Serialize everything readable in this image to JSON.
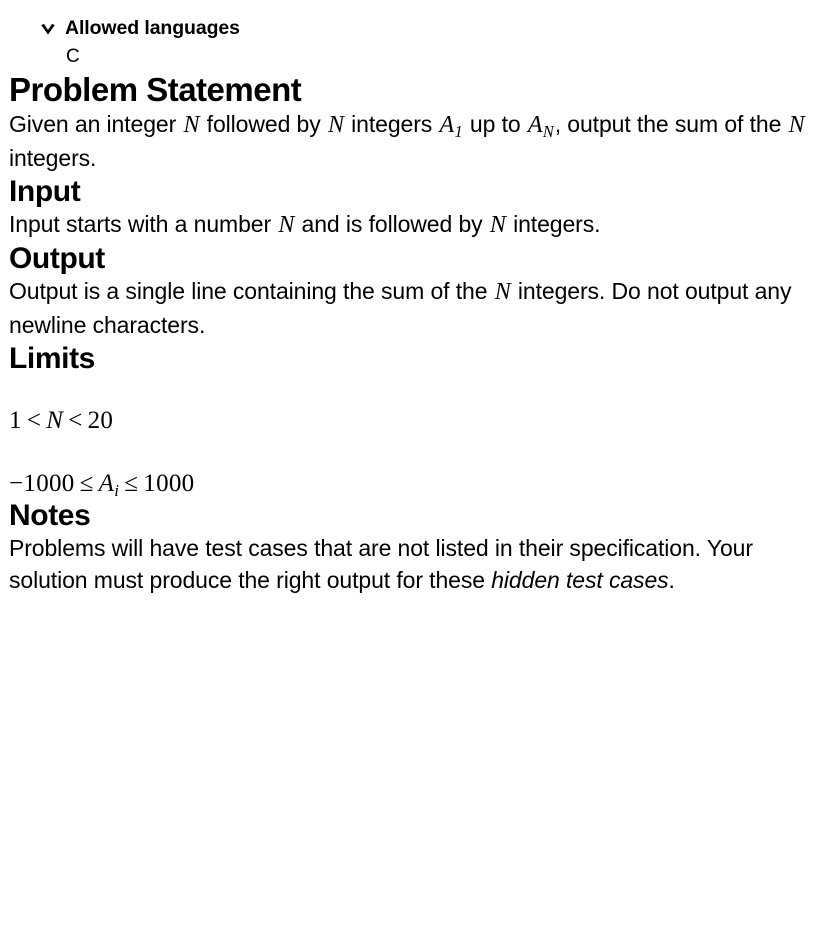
{
  "allowed_languages": {
    "title": "Allowed languages",
    "disclosure_icon": "chevron-down-icon",
    "expanded": true,
    "languages": [
      "C"
    ]
  },
  "sections": {
    "problem_statement": {
      "heading": "Problem Statement",
      "line1_a": "Given an integer ",
      "var_n_1": "N",
      "line1_b": " followed by ",
      "var_n_2": "N",
      "line1_c": " integers ",
      "var_a1": "A",
      "sub_1": "1",
      "line1_d": " up to ",
      "var_an": "A",
      "sub_n": "N",
      "line1_e": ", output the sum of the ",
      "var_n_3": "N",
      "line1_f": " integers."
    },
    "input": {
      "heading": "Input",
      "text_a": "Input starts with a number ",
      "var_n_1": "N",
      "text_b": " and is followed by ",
      "var_n_2": "N",
      "text_c": " integers."
    },
    "output": {
      "heading": "Output",
      "text_a": "Output is a single line containing the sum of the ",
      "var_n": "N",
      "text_b": " integers. Do not output any newline characters."
    },
    "limits": {
      "heading": "Limits",
      "constraint_1": {
        "lower": "1",
        "op_left": "<",
        "variable": "N",
        "op_right": "<",
        "upper": "20"
      },
      "constraint_2": {
        "lower": "−1000",
        "op_left": "≤",
        "variable": "A",
        "subscript": "i",
        "op_right": "≤",
        "upper": "1000"
      }
    },
    "notes": {
      "heading": "Notes",
      "text_a": "Problems will have test cases that are not listed in their specification. Your solution must produce the right output for these ",
      "emphasis": "hidden test cases",
      "text_b": "."
    }
  },
  "colors": {
    "background": "#ffffff",
    "text": "#000000"
  }
}
